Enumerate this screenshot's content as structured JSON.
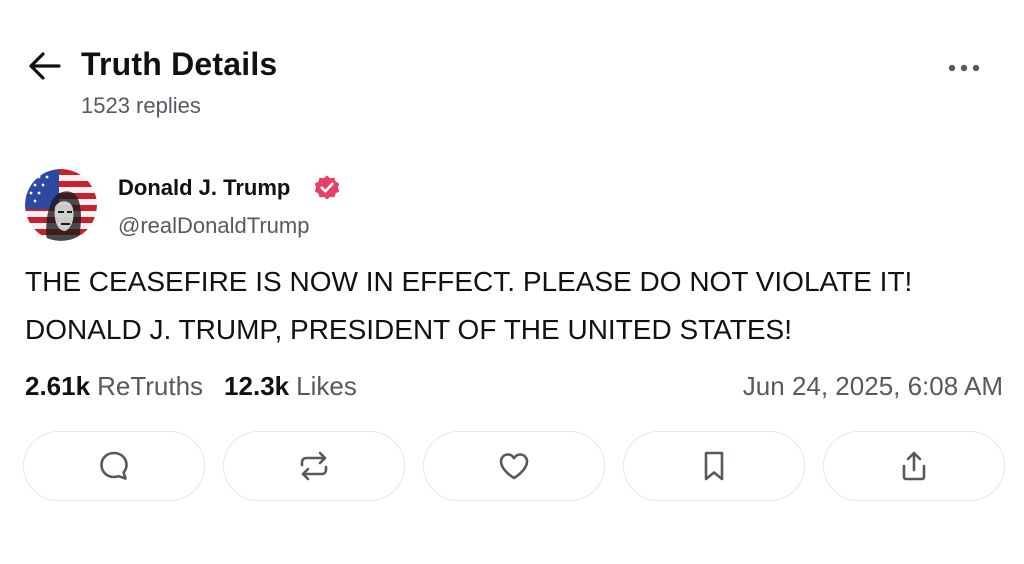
{
  "header": {
    "title": "Truth Details",
    "reply_count": "1523 replies",
    "back_icon": "arrow-left-icon",
    "more_icon": "more-horizontal-icon"
  },
  "post": {
    "author": {
      "name": "Donald J. Trump",
      "handle": "@realDonaldTrump",
      "verified": true,
      "verified_color": "#e8406a"
    },
    "text_lines": [
      "THE CEASEFIRE IS NOW IN EFFECT. PLEASE DO NOT VIOLATE IT!",
      "DONALD J. TRUMP, PRESIDENT OF THE UNITED STATES!"
    ],
    "stats": {
      "retruths_count": "2.61k",
      "retruths_label": "ReTruths",
      "likes_count": "12.3k",
      "likes_label": "Likes"
    },
    "timestamp": "Jun 24, 2025, 6:08 AM"
  },
  "actions": [
    {
      "name": "reply-button",
      "icon": "comment-icon"
    },
    {
      "name": "retruth-button",
      "icon": "repost-icon"
    },
    {
      "name": "like-button",
      "icon": "heart-icon"
    },
    {
      "name": "bookmark-button",
      "icon": "bookmark-icon"
    },
    {
      "name": "share-button",
      "icon": "share-icon"
    }
  ],
  "colors": {
    "text_primary": "#111111",
    "text_secondary": "#555a60",
    "button_border": "#e6e7ea",
    "icon": "#555a60"
  }
}
